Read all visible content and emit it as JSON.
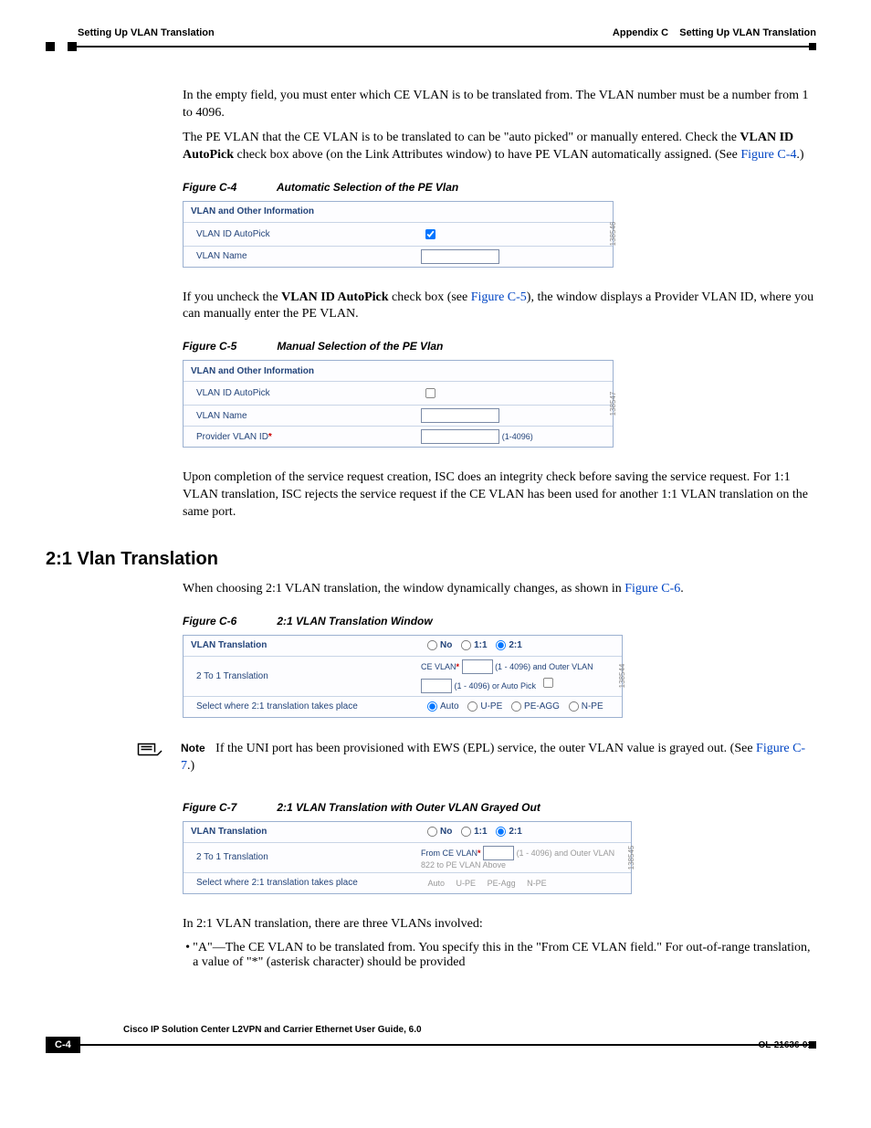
{
  "header": {
    "left": "Setting Up VLAN Translation",
    "right_prefix": "Appendix C",
    "right_title": "Setting Up VLAN Translation"
  },
  "para1": "In the empty field, you must enter which CE VLAN is to be translated from. The VLAN number must be a number from 1 to 4096.",
  "para2a": "The PE VLAN that the CE VLAN is to be translated to can be \"auto picked\" or manually entered. Check the ",
  "para2bold": "VLAN ID AutoPick",
  "para2b": " check box above (on the Link Attributes window) to have PE VLAN automatically assigned. (See ",
  "para2link": "Figure C-4",
  "para2c": ".)",
  "figC4": {
    "num": "Figure C-4",
    "title": "Automatic Selection of the PE Vlan",
    "head": "VLAN and Other Information",
    "row1": "VLAN ID AutoPick",
    "row2": "VLAN Name",
    "sideid": "138546"
  },
  "para3a": "If you uncheck the ",
  "para3bold": "VLAN ID AutoPick",
  "para3b": " check box (see ",
  "para3link": "Figure C-5",
  "para3c": "), the window displays a Provider VLAN ID, where you can manually enter the PE VLAN.",
  "figC5": {
    "num": "Figure C-5",
    "title": "Manual Selection of the PE Vlan",
    "head": "VLAN and Other Information",
    "row1": "VLAN ID AutoPick",
    "row2": "VLAN Name",
    "row3": "Provider VLAN ID",
    "range": "(1-4096)",
    "sideid": "138547"
  },
  "para4": "Upon completion of the service request creation, ISC does an integrity check before saving the service request. For 1:1 VLAN translation, ISC rejects the service request if the CE VLAN has been used for another 1:1 VLAN translation on the same port.",
  "section2": "2:1 Vlan Translation",
  "para5a": "When choosing 2:1 VLAN translation, the window dynamically changes, as shown in ",
  "para5link": "Figure C-6",
  "para5b": ".",
  "figC6": {
    "num": "Figure C-6",
    "title": "2:1 VLAN Translation Window",
    "head": "VLAN Translation",
    "optNo": "No",
    "opt11": "1:1",
    "opt21": "2:1",
    "row2label": "2 To 1 Translation",
    "row2_ce": "CE VLAN",
    "row2_range1": "(1 - 4096) and Outer VLAN",
    "row2_range2": "(1 - 4096) or Auto Pick",
    "row3label": "Select where 2:1 translation takes place",
    "r3a": "Auto",
    "r3b": "U-PE",
    "r3c": "PE-AGG",
    "r3d": "N-PE",
    "sideid": "138544"
  },
  "note": {
    "label": "Note",
    "text1": "If the UNI port has been provisioned with EWS (EPL) service, the outer VLAN value is grayed out. (See ",
    "link": "Figure C-7",
    "text2": ".)"
  },
  "figC7": {
    "num": "Figure C-7",
    "title": "2:1 VLAN Translation with Outer VLAN Grayed Out",
    "head": "VLAN Translation",
    "optNo": "No",
    "opt11": "1:1",
    "opt21": "2:1",
    "row2label": "2 To 1 Translation",
    "row2_ce": "From CE VLAN",
    "row2_gray": "(1 - 4096) and Outer VLAN 822 to PE VLAN Above",
    "row3label": "Select where 2:1 translation takes place",
    "r3a": "Auto",
    "r3b": "U-PE",
    "r3c": "PE-Agg",
    "r3d": "N-PE",
    "sideid": "138545"
  },
  "para6": "In 2:1 VLAN translation, there are three VLANs involved:",
  "bullet1": "\"A\"—The CE VLAN to be translated from. You specify this in the \"From CE VLAN field.\" For out-of-range translation, a value of \"*\" (asterisk character) should be provided",
  "footer": {
    "title": "Cisco IP Solution Center L2VPN and Carrier Ethernet User Guide, 6.0",
    "page": "C-4",
    "doc": "OL-21636-01"
  }
}
